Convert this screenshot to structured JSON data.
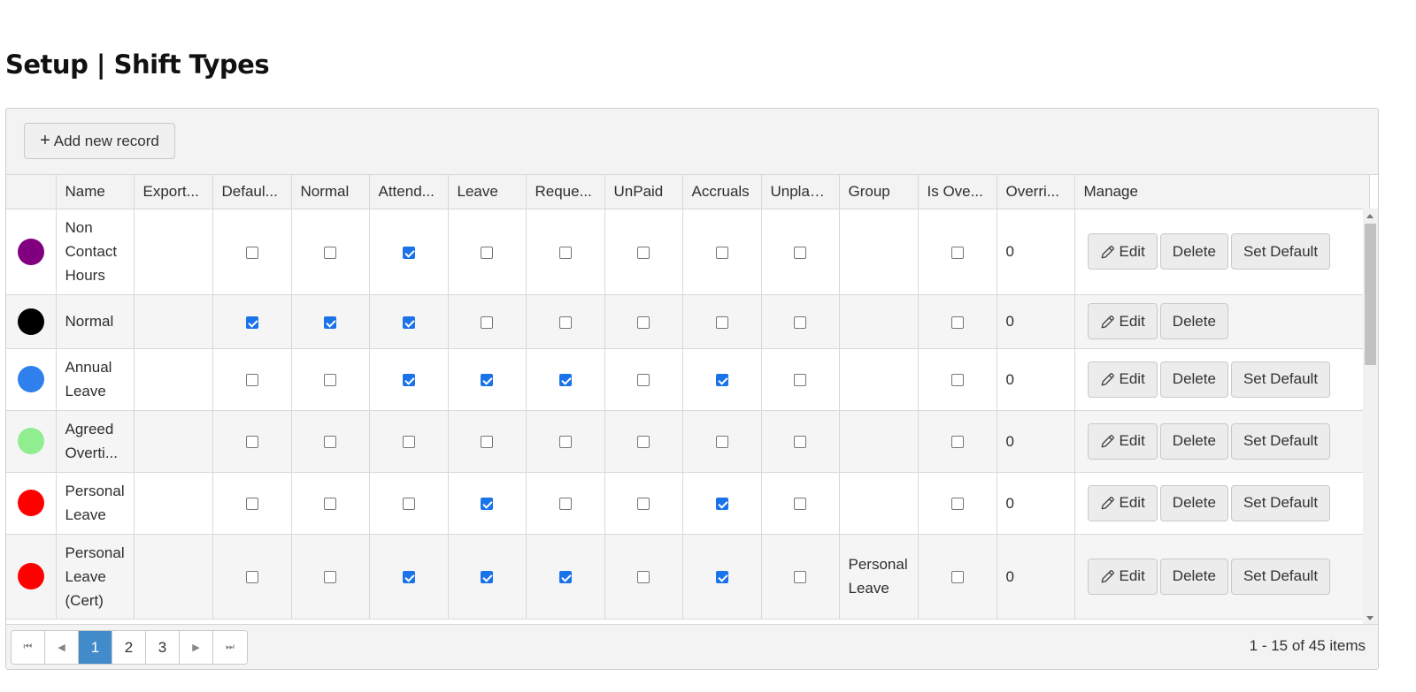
{
  "page_title": "Setup | Shift Types",
  "toolbar": {
    "add_label": "Add new record"
  },
  "columns": [
    "",
    "Name",
    "Export...",
    "Defaul...",
    "Normal",
    "Attend...",
    "Leave",
    "Reque...",
    "UnPaid",
    "Accruals",
    "Unplan...",
    "Group",
    "Is Ove...",
    "Overri...",
    "Manage"
  ],
  "buttons": {
    "edit": "Edit",
    "delete": "Delete",
    "set_default": "Set Default"
  },
  "rows": [
    {
      "color": "#800080",
      "name": "Non Contact Hours",
      "export": "",
      "default": false,
      "normal": false,
      "attendance": true,
      "leave": false,
      "request": false,
      "unpaid": false,
      "accruals": false,
      "unplanned": false,
      "group": "",
      "is_overtime": false,
      "override": "0",
      "set_default": true
    },
    {
      "color": "#000000",
      "name": "Normal",
      "export": "",
      "default": true,
      "normal": true,
      "attendance": true,
      "leave": false,
      "request": false,
      "unpaid": false,
      "accruals": false,
      "unplanned": false,
      "group": "",
      "is_overtime": false,
      "override": "0",
      "set_default": false
    },
    {
      "color": "#2f80ed",
      "name": "Annual Leave",
      "export": "",
      "default": false,
      "normal": false,
      "attendance": true,
      "leave": true,
      "request": true,
      "unpaid": false,
      "accruals": true,
      "unplanned": false,
      "group": "",
      "is_overtime": false,
      "override": "0",
      "set_default": true
    },
    {
      "color": "#90ee90",
      "name": "Agreed Overti...",
      "export": "",
      "default": false,
      "normal": false,
      "attendance": false,
      "leave": false,
      "request": false,
      "unpaid": false,
      "accruals": false,
      "unplanned": false,
      "group": "",
      "is_overtime": false,
      "override": "0",
      "set_default": true
    },
    {
      "color": "#ff0000",
      "name": "Personal Leave",
      "export": "",
      "default": false,
      "normal": false,
      "attendance": false,
      "leave": true,
      "request": false,
      "unpaid": false,
      "accruals": true,
      "unplanned": false,
      "group": "",
      "is_overtime": false,
      "override": "0",
      "set_default": true
    },
    {
      "color": "#ff0000",
      "name": "Personal Leave (Cert)",
      "export": "",
      "default": false,
      "normal": false,
      "attendance": true,
      "leave": true,
      "request": true,
      "unpaid": false,
      "accruals": true,
      "unplanned": false,
      "group": "Personal Leave",
      "is_overtime": false,
      "override": "0",
      "set_default": true
    }
  ],
  "pager": {
    "pages": [
      "1",
      "2",
      "3"
    ],
    "current": "1",
    "info": "1 - 15 of 45 items"
  }
}
